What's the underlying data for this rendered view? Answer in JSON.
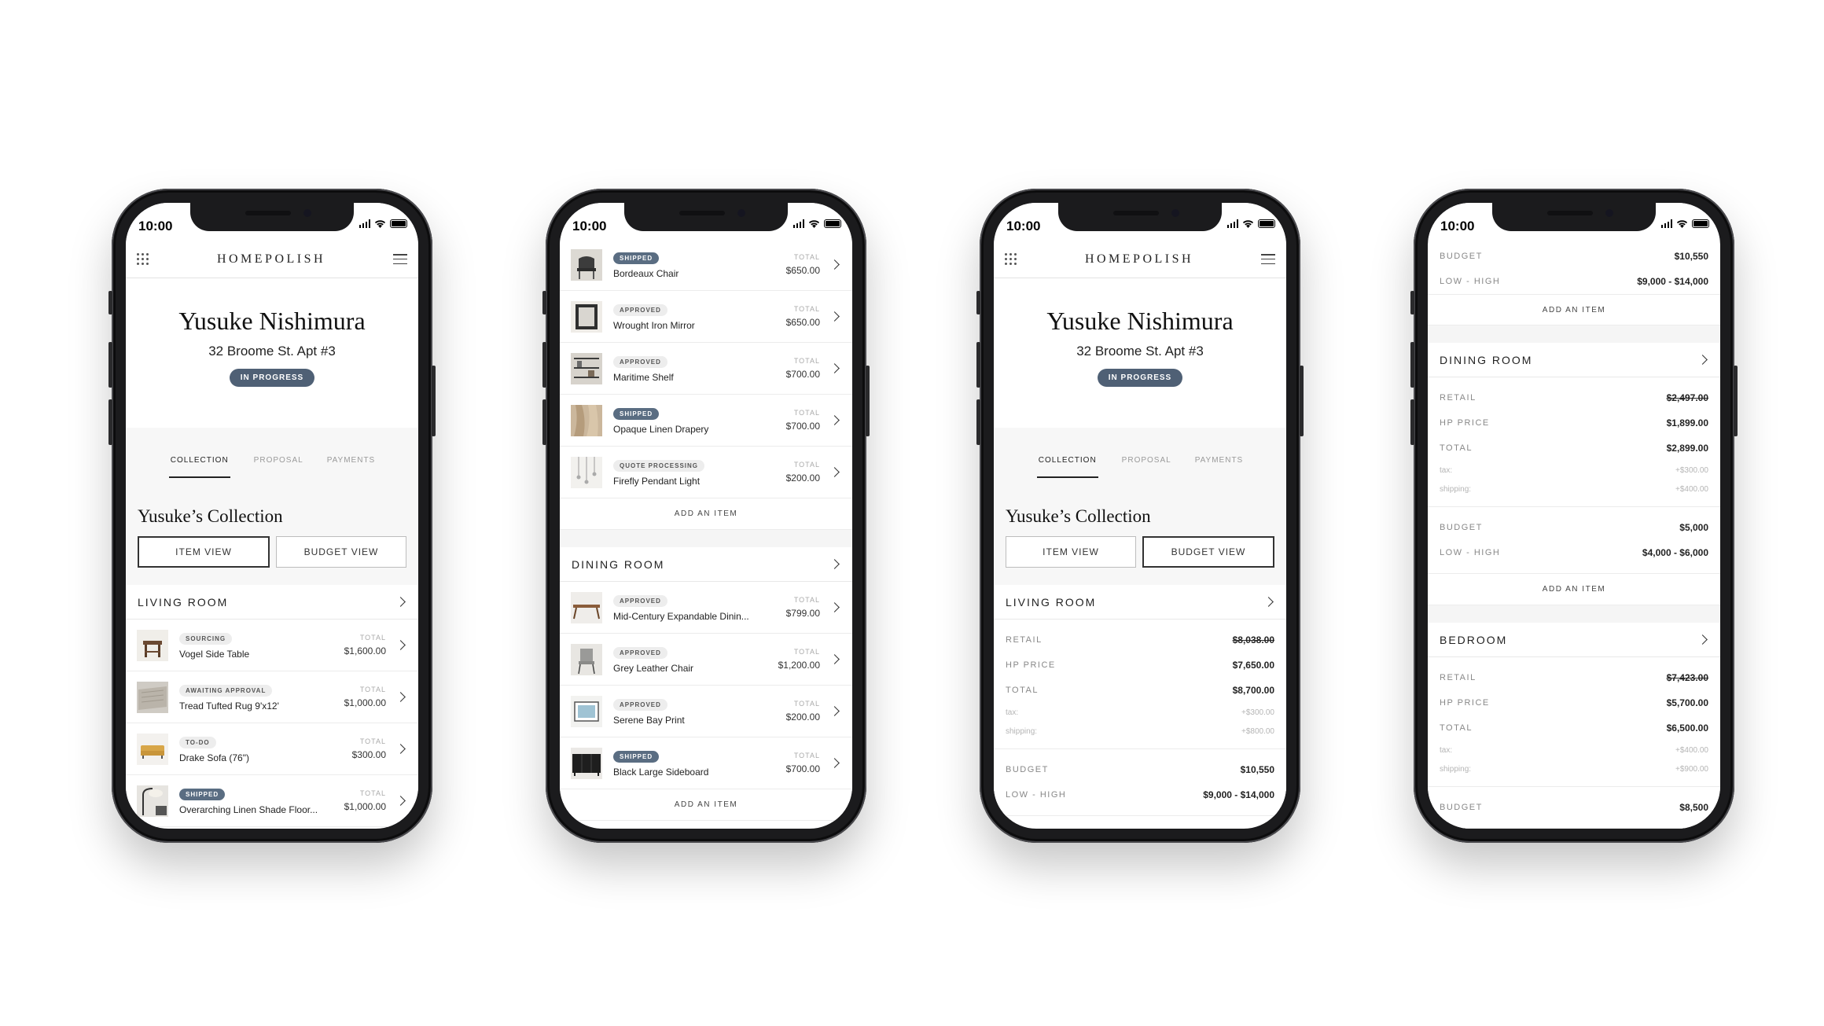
{
  "status_bar": {
    "time": "10:00"
  },
  "app": {
    "brand": "HOMEPOLISH"
  },
  "client": {
    "name": "Yusuke Nishimura",
    "address": "32 Broome St. Apt #3",
    "status": "IN PROGRESS"
  },
  "tabs": [
    {
      "label": "COLLECTION",
      "active": true
    },
    {
      "label": "PROPOSAL",
      "active": false
    },
    {
      "label": "PAYMENTS",
      "active": false
    }
  ],
  "collection_title": "Yusuke’s Collection",
  "view_toggle": {
    "item_view": "ITEM VIEW",
    "budget_view": "BUDGET VIEW"
  },
  "total_label": "TOTAL",
  "add_item_label": "ADD AN ITEM",
  "rooms": {
    "living": "LIVING ROOM",
    "dining": "DINING ROOM",
    "bedroom": "BEDROOM"
  },
  "living_items": [
    {
      "status": "SOURCING",
      "name": "Vogel Side Table",
      "total": "$1,600.00"
    },
    {
      "status": "AWAITING APPROVAL",
      "name": "Tread Tufted Rug 9'x12'",
      "total": "$1,000.00"
    },
    {
      "status": "TO-DO",
      "name": "Drake Sofa (76\")",
      "total": "$300.00"
    },
    {
      "status": "SHIPPED",
      "name": "Overarching Linen Shade Floor...",
      "total": "$1,000.00"
    }
  ],
  "screen2_items": [
    {
      "status": "SHIPPED",
      "name": "Bordeaux Chair",
      "total": "$650.00"
    },
    {
      "status": "APPROVED",
      "name": "Wrought Iron Mirror",
      "total": "$650.00"
    },
    {
      "status": "APPROVED",
      "name": "Maritime Shelf",
      "total": "$700.00"
    },
    {
      "status": "SHIPPED",
      "name": "Opaque Linen Drapery",
      "total": "$700.00"
    },
    {
      "status": "QUOTE PROCESSING",
      "name": "Firefly Pendant Light",
      "total": "$200.00"
    }
  ],
  "dining_items": [
    {
      "status": "APPROVED",
      "name": "Mid-Century Expandable Dinin...",
      "total": "$799.00"
    },
    {
      "status": "APPROVED",
      "name": "Grey Leather Chair",
      "total": "$1,200.00"
    },
    {
      "status": "APPROVED",
      "name": "Serene Bay Print",
      "total": "$200.00"
    },
    {
      "status": "SHIPPED",
      "name": "Black Large Sideboard",
      "total": "$700.00"
    }
  ],
  "budget_labels": {
    "retail": "RETAIL",
    "hp_price": "HP PRICE",
    "total": "TOTAL",
    "tax": "tax:",
    "shipping": "shipping:",
    "budget": "BUDGET",
    "low_high": "LOW - HIGH"
  },
  "living_budget": {
    "retail": "$8,038.00",
    "hp_price": "$7,650.00",
    "total": "$8,700.00",
    "tax": "+$300.00",
    "shipping": "+$800.00",
    "budget": "$10,550",
    "low_high": "$9,000 - $14,000"
  },
  "living_budget_top": {
    "budget": "$10,550",
    "low_high": "$9,000 - $14,000"
  },
  "dining_budget": {
    "retail": "$2,497.00",
    "hp_price": "$1,899.00",
    "total": "$2,899.00",
    "tax": "+$300.00",
    "shipping": "+$400.00",
    "budget": "$5,000",
    "low_high": "$4,000 - $6,000"
  },
  "bedroom_budget": {
    "retail": "$7,423.00",
    "hp_price": "$5,700.00",
    "total": "$6,500.00",
    "tax": "+$400.00",
    "shipping": "+$900.00",
    "budget": "$8,500"
  }
}
